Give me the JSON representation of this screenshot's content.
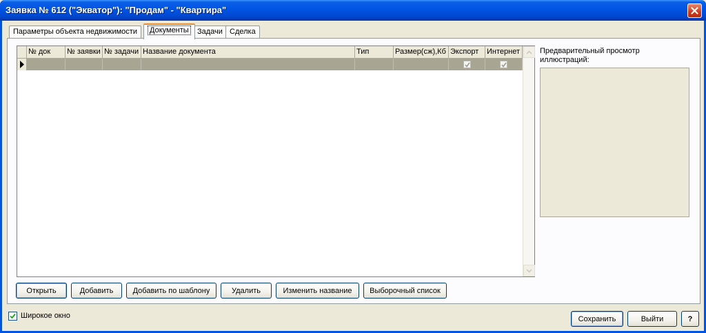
{
  "window": {
    "title": "Заявка № 612 (\"Экватор\"): \"Продам\" - \"Квартира\""
  },
  "tabs": [
    {
      "label": "Параметры объекта недвижимости",
      "active": false
    },
    {
      "label": "Документы",
      "active": true
    },
    {
      "label": "Задачи",
      "active": false
    },
    {
      "label": "Сделка",
      "active": false
    }
  ],
  "grid": {
    "columns": [
      "№ док",
      "№ заявки",
      "№ задачи",
      "Название документа",
      "Тип",
      "Размер(сж),Кб",
      "Экспорт",
      "Интернет"
    ],
    "rows": [
      {
        "doc_no": "",
        "request_no": "",
        "task_no": "",
        "name": "",
        "type": "",
        "size": "",
        "export": true,
        "internet": true
      }
    ]
  },
  "preview": {
    "label": "Предварительный просмотр иллюстраций:"
  },
  "actions": {
    "open": "Открыть",
    "add": "Добавить",
    "add_template": "Добавить по шаблону",
    "delete": "Удалить",
    "rename": "Изменить название",
    "selection_list": "Выборочный список"
  },
  "footer": {
    "wide_window_label": "Широкое окно",
    "wide_window_checked": true,
    "save": "Сохранить",
    "exit": "Выйти",
    "help": "?"
  },
  "icons": {
    "close": "close-icon",
    "row_indicator": "row-pointer-icon",
    "scroll_up": "scroll-up-icon",
    "scroll_down": "scroll-down-icon",
    "check": "checkmark-icon"
  }
}
